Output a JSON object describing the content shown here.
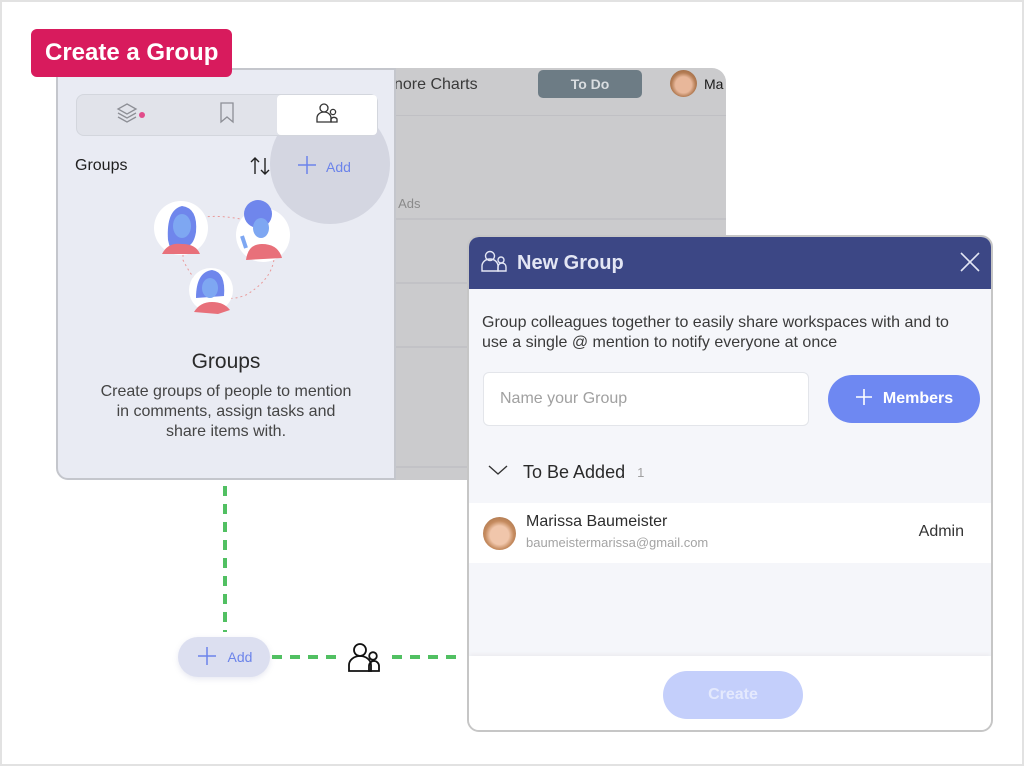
{
  "badge": {
    "title": "Create a Group",
    "color": "#d81b5d"
  },
  "background_app": {
    "breadcrumb": "nore Charts",
    "todo_button": "To Do",
    "user_name_partial": "Ma",
    "column_label_partial": "e Ads"
  },
  "panel": {
    "tabs": [
      {
        "icon": "layers-icon",
        "has_notification_dot": true,
        "active": false
      },
      {
        "icon": "bookmark-icon",
        "active": false
      },
      {
        "icon": "people-icon",
        "active": true
      }
    ],
    "section_title": "Groups",
    "sort_icon": "sort-arrows-icon",
    "add_label": "Add",
    "empty_state": {
      "title": "Groups",
      "description": "Create groups of people to mention in comments, assign tasks and share items with."
    }
  },
  "connector": {
    "add_label": "Add",
    "line_color": "#51c062"
  },
  "dialog": {
    "title": "New Group",
    "header_color": "#3c4785",
    "description": "Group colleagues together to easily share workspaces with and to use a single @ mention to notify everyone at once",
    "name_input": {
      "placeholder": "Name your Group",
      "value": ""
    },
    "members_button": "Members",
    "section": {
      "label": "To Be Added",
      "count": "1"
    },
    "members": [
      {
        "name": "Marissa Baumeister",
        "email": "baumeistermarissa@gmail.com",
        "role": "Admin"
      }
    ],
    "create_button": "Create",
    "accent_color": "#6e88f2"
  }
}
